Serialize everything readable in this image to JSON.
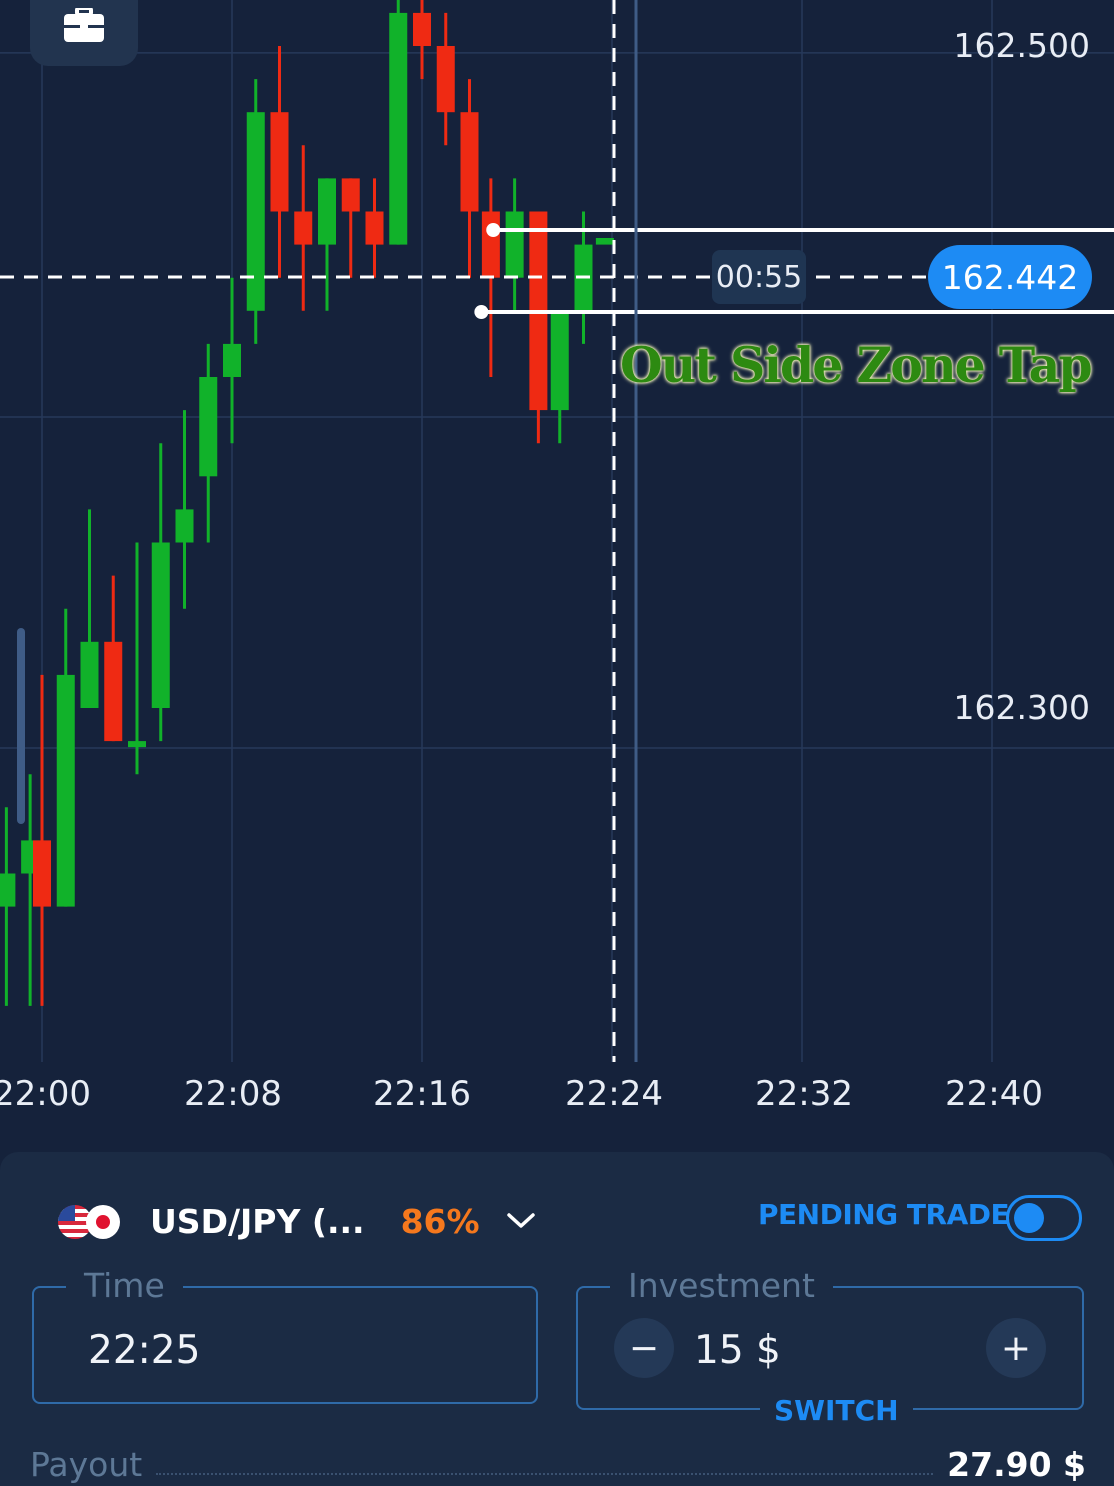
{
  "chart": {
    "price_axis": {
      "labels": [
        {
          "text": "162.500",
          "price": 162.5
        },
        {
          "text": "162.300",
          "price": 162.3
        }
      ]
    },
    "time_axis": {
      "labels": [
        {
          "text": "22:00",
          "minute": 0
        },
        {
          "text": "22:08",
          "minute": 8
        },
        {
          "text": "22:16",
          "minute": 16
        },
        {
          "text": "22:24",
          "minute": 24
        },
        {
          "text": "22:32",
          "minute": 32
        },
        {
          "text": "22:40",
          "minute": 40
        }
      ]
    },
    "timer": "00:55",
    "current_price": "162.442",
    "annotation": "Out Side Zone Tap",
    "colors": {
      "up": "#11b22a",
      "down": "#ef2a13",
      "accent": "#1d8bf4",
      "payout_pct": "#f5781d",
      "background": "#15223b"
    }
  },
  "chart_data": {
    "type": "candlestick",
    "x_unit": "minutes after 22:00",
    "y_unit": "USD/JPY price",
    "ylim_visible": [
      162.04,
      162.52
    ],
    "candles": [
      {
        "t": -1.5,
        "o": 162.24,
        "h": 162.27,
        "l": 162.21,
        "c": 162.25
      },
      {
        "t": -0.5,
        "o": 162.25,
        "h": 162.28,
        "l": 162.21,
        "c": 162.26
      },
      {
        "t": 0.0,
        "o": 162.26,
        "h": 162.31,
        "l": 162.21,
        "c": 162.24
      },
      {
        "t": 1.0,
        "o": 162.24,
        "h": 162.33,
        "l": 162.24,
        "c": 162.31
      },
      {
        "t": 2.0,
        "o": 162.3,
        "h": 162.36,
        "l": 162.31,
        "c": 162.32
      },
      {
        "t": 3.0,
        "o": 162.32,
        "h": 162.34,
        "l": 162.29,
        "c": 162.29
      },
      {
        "t": 4.0,
        "o": 162.29,
        "h": 162.35,
        "l": 162.28,
        "c": 162.29
      },
      {
        "t": 5.0,
        "o": 162.3,
        "h": 162.38,
        "l": 162.29,
        "c": 162.35
      },
      {
        "t": 6.0,
        "o": 162.35,
        "h": 162.39,
        "l": 162.33,
        "c": 162.36
      },
      {
        "t": 7.0,
        "o": 162.37,
        "h": 162.41,
        "l": 162.35,
        "c": 162.4
      },
      {
        "t": 8.0,
        "o": 162.4,
        "h": 162.43,
        "l": 162.38,
        "c": 162.41
      },
      {
        "t": 9.0,
        "o": 162.42,
        "h": 162.49,
        "l": 162.41,
        "c": 162.48
      },
      {
        "t": 10.0,
        "o": 162.48,
        "h": 162.5,
        "l": 162.43,
        "c": 162.45
      },
      {
        "t": 11.0,
        "o": 162.45,
        "h": 162.47,
        "l": 162.42,
        "c": 162.44
      },
      {
        "t": 12.0,
        "o": 162.44,
        "h": 162.46,
        "l": 162.42,
        "c": 162.46
      },
      {
        "t": 13.0,
        "o": 162.46,
        "h": 162.46,
        "l": 162.43,
        "c": 162.45
      },
      {
        "t": 14.0,
        "o": 162.45,
        "h": 162.46,
        "l": 162.43,
        "c": 162.44
      },
      {
        "t": 15.0,
        "o": 162.44,
        "h": 162.52,
        "l": 162.44,
        "c": 162.51
      },
      {
        "t": 16.0,
        "o": 162.51,
        "h": 162.52,
        "l": 162.49,
        "c": 162.5
      },
      {
        "t": 17.0,
        "o": 162.5,
        "h": 162.51,
        "l": 162.47,
        "c": 162.48
      },
      {
        "t": 18.0,
        "o": 162.48,
        "h": 162.49,
        "l": 162.43,
        "c": 162.45
      },
      {
        "t": 18.9,
        "o": 162.45,
        "h": 162.46,
        "l": 162.4,
        "c": 162.43
      },
      {
        "t": 19.9,
        "o": 162.43,
        "h": 162.46,
        "l": 162.42,
        "c": 162.45
      },
      {
        "t": 20.9,
        "o": 162.45,
        "h": 162.45,
        "l": 162.38,
        "c": 162.39
      },
      {
        "t": 21.8,
        "o": 162.39,
        "h": 162.4,
        "l": 162.38,
        "c": 162.42
      },
      {
        "t": 22.8,
        "o": 162.42,
        "h": 162.45,
        "l": 162.41,
        "c": 162.44
      },
      {
        "t": 23.7,
        "o": 162.44,
        "h": 162.44,
        "l": 162.44,
        "c": 162.442
      }
    ],
    "zone": {
      "upper": 162.455,
      "lower": 162.43
    },
    "current_price": 162.442,
    "expiry_minute": 24.7
  },
  "panel": {
    "asset": "USD/JPY (...",
    "payout_percent": "86%",
    "pending_trade_label": "PENDING TRADE",
    "pending_trade_on": false,
    "time": {
      "label": "Time",
      "value": "22:25"
    },
    "investment": {
      "label": "Investment",
      "value": "15 $",
      "minus": "−",
      "plus": "+",
      "switch_label": "SWITCH"
    },
    "payout": {
      "label": "Payout",
      "value": "27.90 $"
    }
  }
}
